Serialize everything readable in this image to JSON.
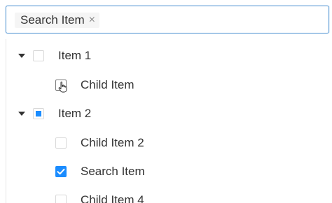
{
  "selected_tag": {
    "label": "Search Item",
    "remove_symbol": "×"
  },
  "tree": [
    {
      "label": "Item 1",
      "expanded": true,
      "state": "unchecked"
    },
    {
      "label": "Child Item",
      "state": "unchecked"
    },
    {
      "label": "Item 2",
      "expanded": true,
      "state": "indeterminate"
    },
    {
      "label": "Child Item 2",
      "state": "unchecked"
    },
    {
      "label": "Search Item",
      "state": "checked"
    },
    {
      "label": "Child Item 4",
      "state": "unchecked"
    }
  ],
  "colors": {
    "accent": "#1a8cff",
    "focus_border": "#5b9bd5"
  },
  "icons": {
    "caret": "caret-down-icon",
    "checkmark": "checkmark-icon",
    "cursor": "hand-pointer-icon"
  }
}
